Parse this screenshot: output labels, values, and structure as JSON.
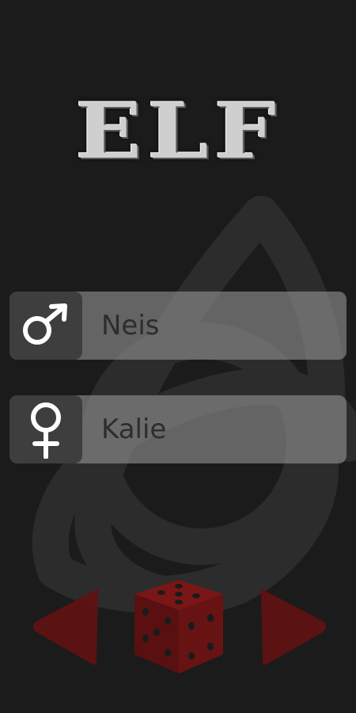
{
  "logo": {
    "text": "ELF"
  },
  "male": {
    "name": "Neis",
    "icon": "male-symbol-icon"
  },
  "female": {
    "name": "Kalie",
    "icon": "female-symbol-icon"
  },
  "controls": {
    "prev_icon": "left-arrow-icon",
    "random_icon": "dice-icon",
    "next_icon": "right-arrow-icon"
  },
  "colors": {
    "background": "#1b1b1b",
    "accent_red": "#6a1010",
    "row_bg": "#8f8f8f",
    "icon_bg": "#3e3e3e"
  }
}
